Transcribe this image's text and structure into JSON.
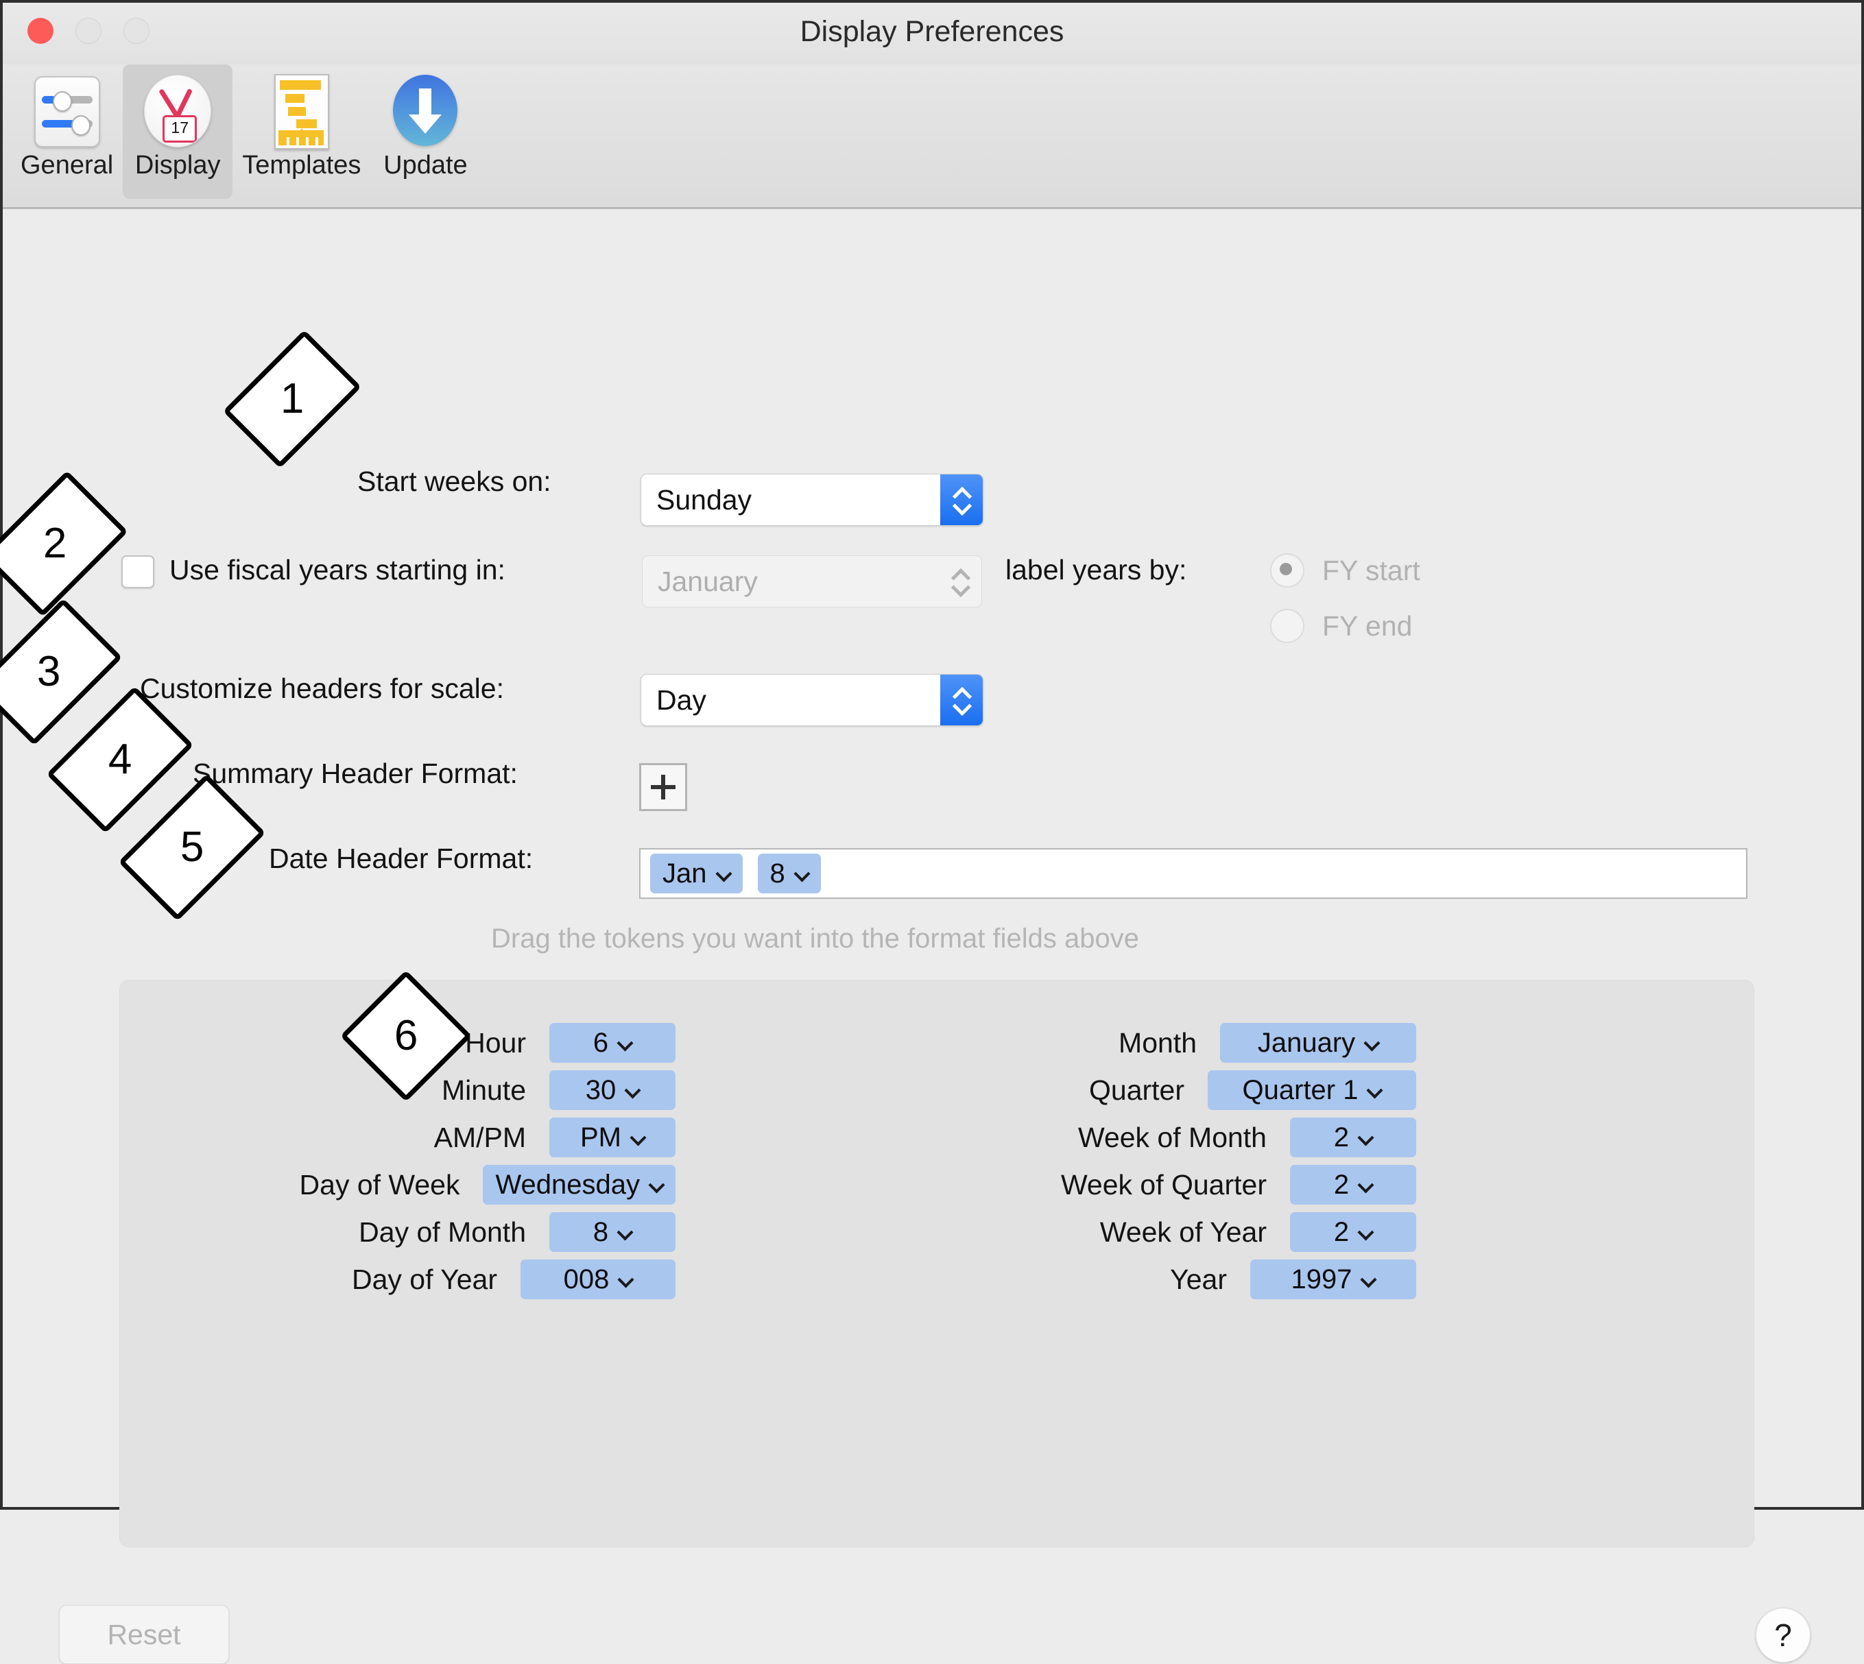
{
  "window": {
    "title": "Display Preferences",
    "traffic_lights": [
      "close",
      "minimize",
      "maximize"
    ]
  },
  "toolbar": {
    "items": [
      {
        "label": "General",
        "icon": "sliders-icon",
        "selected": false
      },
      {
        "label": "Display",
        "icon": "clock-calendar-icon",
        "selected": true
      },
      {
        "label": "Templates",
        "icon": "template-sheet-icon",
        "selected": false
      },
      {
        "label": "Update",
        "icon": "download-arrow-icon",
        "selected": false
      }
    ]
  },
  "settings": {
    "start_weeks_label": "Start weeks on:",
    "start_weeks_value": "Sunday",
    "fiscal_checkbox_label": "Use fiscal years starting in:",
    "fiscal_checked": false,
    "fiscal_month_value": "January",
    "fiscal_month_enabled": false,
    "label_years_by_label": "label years by:",
    "label_years_options": [
      {
        "label": "FY start",
        "selected": true
      },
      {
        "label": "FY end",
        "selected": false
      }
    ],
    "customize_headers_label": "Customize headers for scale:",
    "customize_headers_value": "Day",
    "summary_header_label": "Summary Header Format:",
    "summary_header_add": "+",
    "date_header_label": "Date Header Format:",
    "date_header_tokens": [
      "Jan",
      "8"
    ],
    "drag_hint": "Drag the tokens you want into the format fields above"
  },
  "palette": {
    "left": [
      {
        "label": "Hour",
        "token": "6"
      },
      {
        "label": "Minute",
        "token": "30"
      },
      {
        "label": "AM/PM",
        "token": "PM"
      },
      {
        "label": "Day of Week",
        "token": "Wednesday"
      },
      {
        "label": "Day of Month",
        "token": "8"
      },
      {
        "label": "Day of Year",
        "token": "008"
      }
    ],
    "right": [
      {
        "label": "Month",
        "token": "January"
      },
      {
        "label": "Quarter",
        "token": "Quarter 1"
      },
      {
        "label": "Week of Month",
        "token": "2"
      },
      {
        "label": "Week of Quarter",
        "token": "2"
      },
      {
        "label": "Week of Year",
        "token": "2"
      },
      {
        "label": "Year",
        "token": "1997"
      }
    ]
  },
  "footer": {
    "reset_label": "Reset",
    "reset_enabled": false,
    "help_label": "?"
  },
  "annotations": [
    {
      "number": "1"
    },
    {
      "number": "2"
    },
    {
      "number": "3"
    },
    {
      "number": "4"
    },
    {
      "number": "5"
    },
    {
      "number": "6"
    }
  ],
  "colors": {
    "accent_blue": "#1a6ff0",
    "token_blue": "#a9c6ee",
    "close_red": "#fc5b57",
    "window_bg": "#ececec",
    "palette_bg": "#e2e2e2"
  }
}
